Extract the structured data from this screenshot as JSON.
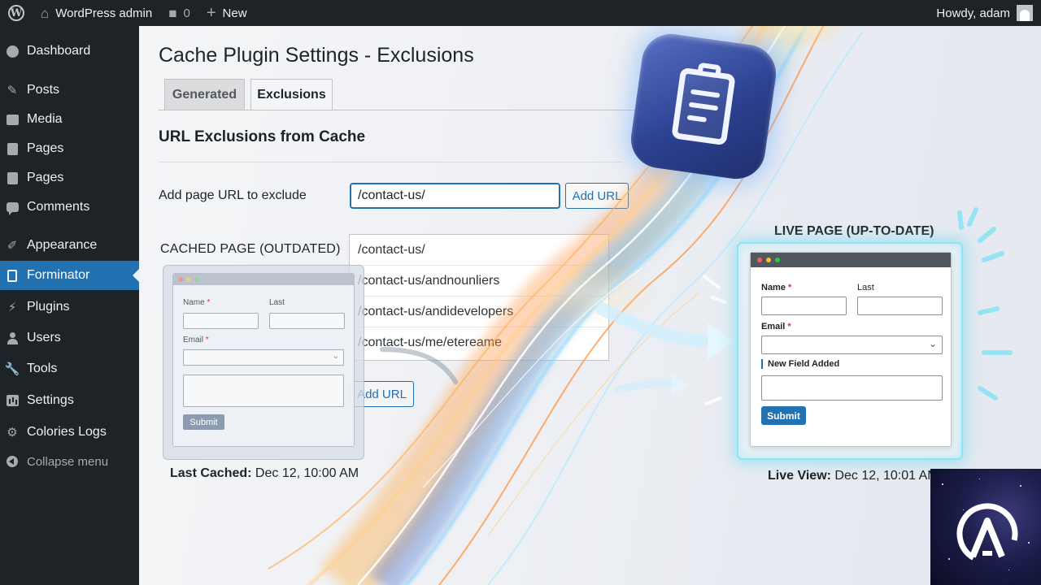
{
  "admin_bar": {
    "site_name": "WordPress admin",
    "comments_count": "0",
    "new_label": "New",
    "howdy": "Howdy, adam"
  },
  "sidebar": {
    "items": [
      {
        "label": "Dashboard",
        "icon": "dashboard-icon"
      },
      {
        "label": "Posts",
        "icon": "pin-icon"
      },
      {
        "label": "Media",
        "icon": "media-icon"
      },
      {
        "label": "Pages",
        "icon": "page-icon"
      },
      {
        "label": "Pages",
        "icon": "page-icon"
      },
      {
        "label": "Comments",
        "icon": "comment-icon"
      },
      {
        "label": "Appearance",
        "icon": "brush-icon"
      },
      {
        "label": "Forminator",
        "icon": "form-icon",
        "current": true
      },
      {
        "label": "Plugins",
        "icon": "plug-icon"
      },
      {
        "label": "Users",
        "icon": "user-icon"
      },
      {
        "label": "Tools",
        "icon": "wrench-icon"
      },
      {
        "label": "Settings",
        "icon": "settings-icon"
      },
      {
        "label": "Colories Logs",
        "icon": "gear-icon"
      },
      {
        "label": "Collapse menu",
        "icon": "collapse-icon"
      }
    ]
  },
  "page": {
    "title": "Cache Plugin Settings - Exclusions",
    "tabs": [
      "Generated",
      "Exclusions"
    ],
    "active_tab": "Exclusions",
    "section_title": "URL Exclusions from Cache",
    "add_label": "Add page URL to exclude",
    "url_input_value": "/contact-us/",
    "add_button": "Add URL",
    "url_list": [
      "/contact-us/",
      "/contact-us/andnounliers",
      "/contact-us/andidevelopers",
      "/contact-us/me/etereame"
    ],
    "add_button_2": "Add URL"
  },
  "cached": {
    "title": "CACHED PAGE (OUTDATED)",
    "form": {
      "name_label": "Name",
      "last_label": "Last",
      "email_label": "Email",
      "submit": "Submit"
    },
    "caption_bold": "Last Cached:",
    "caption_value": "Dec 12, 10:00 AM"
  },
  "live": {
    "title": "LIVE PAGE (UP-TO-DATE)",
    "form": {
      "name_label": "Name",
      "last_label": "Last",
      "email_label": "Email",
      "new_field": "New Field Added",
      "submit": "Submit"
    },
    "caption_bold": "Live View:",
    "caption_value": "Dec 12, 10:01 AM"
  },
  "colors": {
    "admin_bar_bg": "#1d2327",
    "accent": "#2271b1",
    "required": "#d63638",
    "glow": "#8ee3f5"
  }
}
